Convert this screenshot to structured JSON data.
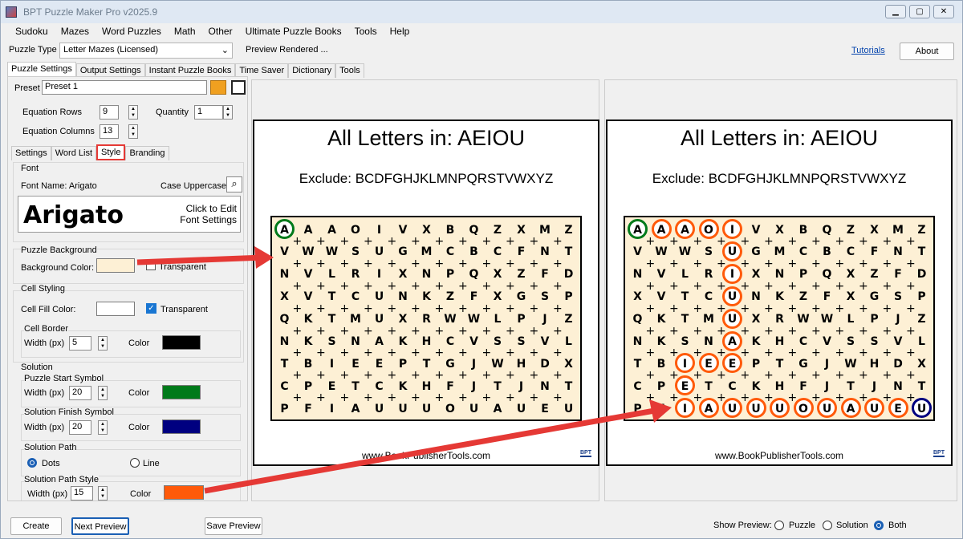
{
  "window": {
    "title": "BPT Puzzle Maker Pro v2025.9"
  },
  "menu": [
    "Sudoku",
    "Mazes",
    "Word Puzzles",
    "Math",
    "Other",
    "Ultimate Puzzle Books",
    "Tools",
    "Help"
  ],
  "toolbar": {
    "puzzle_type_label": "Puzzle Type",
    "puzzle_type_value": "Letter Mazes (Licensed)",
    "status": "Preview Rendered ...",
    "tutorials": "Tutorials",
    "about": "About"
  },
  "main_tabs": [
    "Puzzle Settings",
    "Output Settings",
    "Instant Puzzle Books",
    "Time Saver",
    "Dictionary",
    "Tools"
  ],
  "settings": {
    "preset_label": "Preset",
    "preset_value": "Preset 1",
    "eq_rows_label": "Equation Rows",
    "eq_rows_value": "9",
    "quantity_label": "Quantity",
    "quantity_value": "1",
    "eq_cols_label": "Equation Columns",
    "eq_cols_value": "13"
  },
  "sub_tabs": [
    "Settings",
    "Word List",
    "Style",
    "Branding"
  ],
  "style": {
    "font_group": "Font",
    "font_name": "Font Name: Arigato",
    "case": "Case Uppercase",
    "font_preview": "Arigato",
    "click_edit": "Click to Edit",
    "font_settings": "Font Settings",
    "puzzle_bg_group": "Puzzle Background",
    "bg_color_label": "Background Color:",
    "bg_color": "#fdf0d5",
    "bg_transparent": "Transparent",
    "cell_styling_group": "Cell Styling",
    "cell_fill_label": "Cell Fill Color:",
    "cell_fill_color": "#ffffff",
    "cell_transparent": "Transparent",
    "cell_border_group": "Cell Border",
    "width_label": "Width (px)",
    "cell_border_width": "5",
    "color_label": "Color",
    "cell_border_color": "#000000",
    "solution_group": "Solution",
    "start_group": "Puzzle Start Symbol",
    "start_width": "20",
    "start_color": "#007a1a",
    "finish_group": "Solution Finish Symbol",
    "finish_width": "20",
    "finish_color": "#000080",
    "path_group": "Solution Path",
    "dots": "Dots",
    "line": "Line",
    "path_style_group": "Solution Path Style",
    "path_width": "15",
    "path_color": "#ff5a0a"
  },
  "puzzle": {
    "title": "All Letters in: AEIOU",
    "exclude": "Exclude: BCDFGHJKLMNPQRSTVWXYZ",
    "footer": "www.BookPublisherTools.com",
    "logo": "BPT",
    "rows": [
      "AAAOIVXBQZXMZ",
      "VWWSUGMCBCFNT",
      "NVLRIXNPQXZFD",
      "XVTCUNKZFXGSP",
      "QKTMUXRWWLPJZ",
      "NKSNAKHCVSSVL",
      "TBIEEPTGJWHDX",
      "CPETCKHFJTJNT",
      "PFIAUUUOUAUEU"
    ],
    "solution_path": [
      [
        0,
        0
      ],
      [
        0,
        1
      ],
      [
        0,
        2
      ],
      [
        0,
        3
      ],
      [
        0,
        4
      ],
      [
        1,
        4
      ],
      [
        2,
        4
      ],
      [
        3,
        4
      ],
      [
        4,
        4
      ],
      [
        5,
        4
      ],
      [
        6,
        4
      ],
      [
        6,
        3
      ],
      [
        6,
        2
      ],
      [
        7,
        2
      ],
      [
        8,
        2
      ],
      [
        8,
        3
      ],
      [
        8,
        4
      ],
      [
        8,
        5
      ],
      [
        8,
        6
      ],
      [
        8,
        7
      ],
      [
        8,
        8
      ],
      [
        8,
        9
      ],
      [
        8,
        10
      ],
      [
        8,
        11
      ],
      [
        8,
        12
      ]
    ]
  },
  "bottom": {
    "create": "Create",
    "next_preview": "Next Preview",
    "save_preview": "Save Preview",
    "show_preview": "Show Preview:",
    "opt_puzzle": "Puzzle",
    "opt_solution": "Solution",
    "opt_both": "Both"
  }
}
